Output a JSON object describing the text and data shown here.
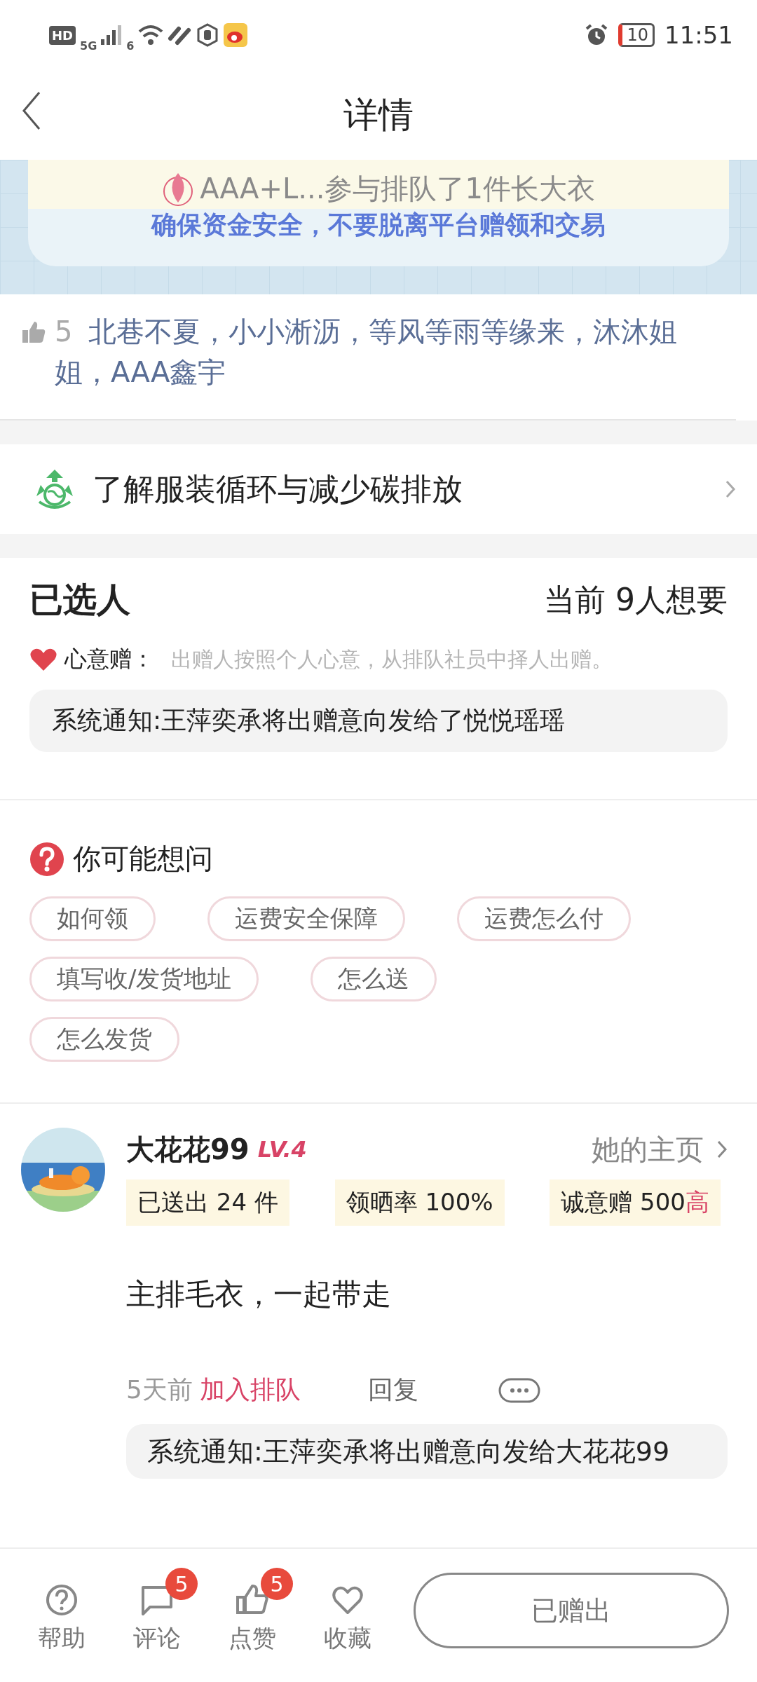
{
  "status_bar": {
    "hd": "HD",
    "network": "5G",
    "wifi": "6",
    "battery": "10",
    "time": "11:51"
  },
  "header": {
    "title": "详情"
  },
  "banner": {
    "toast": "AAA+L...参与排队了1件长大衣",
    "notice": "确保资金安全，不要脱离平台赠领和交易"
  },
  "likes": {
    "count": "5",
    "names": "北巷不夏，小小淅沥，等风等雨等缘来，沐沐姐姐，AAA鑫宇"
  },
  "eco_link": {
    "label": "了解服装循环与减少碳排放"
  },
  "selected": {
    "title": "已选人",
    "count": "当前 9人想要",
    "mode_label": "心意赠：",
    "mode_desc": "出赠人按照个人心意，从排队社员中择人出赠。",
    "notice": "系统通知:王萍奕承将出赠意向发给了悦悦瑶瑶"
  },
  "faq": {
    "title": "你可能想问",
    "chip_rows": [
      [
        "如何领",
        "运费安全保障",
        "运费怎么付"
      ],
      [
        "填写收/发货地址",
        "怎么送"
      ],
      [
        "怎么发货"
      ]
    ]
  },
  "comment": {
    "user": "大花花99",
    "level": "LV.4",
    "profile_link": "她的主页",
    "stats": [
      {
        "label": "已送出 24 件"
      },
      {
        "label": "领晒率 100%"
      },
      {
        "label": "诚意赠 500",
        "highlight": "高"
      }
    ],
    "text": "主排毛衣，一起带走",
    "time": "5天前",
    "action": "加入排队",
    "reply": "回复",
    "notice": "系统通知:王萍奕承将出赠意向发给大花花99"
  },
  "bottom_bar": {
    "items": [
      {
        "kind": "help",
        "label": "帮助"
      },
      {
        "kind": "comment",
        "label": "评论",
        "badge": "5"
      },
      {
        "kind": "like",
        "label": "点赞",
        "badge": "5"
      },
      {
        "kind": "favorite",
        "label": "收藏"
      }
    ],
    "button": "已赠出"
  }
}
